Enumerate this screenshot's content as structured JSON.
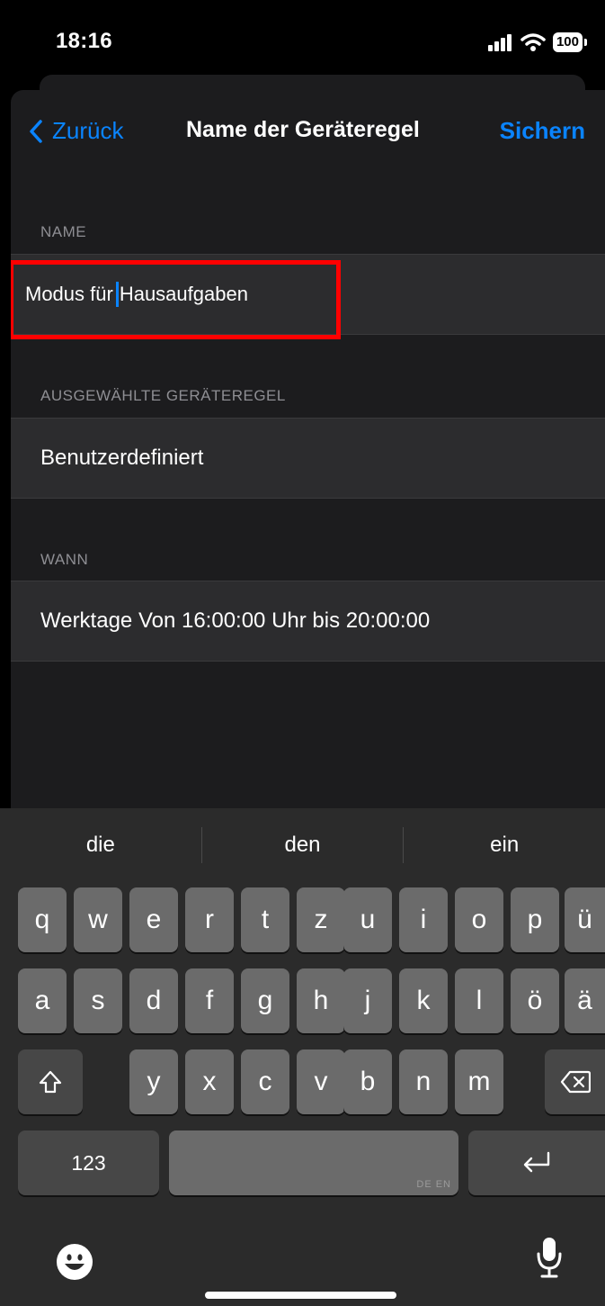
{
  "status_bar": {
    "time": "18:16",
    "battery": "100"
  },
  "nav": {
    "back_label": "Zurück",
    "title": "Name der Geräteregel",
    "save_label": "Sichern"
  },
  "sections": {
    "name_header": "NAME",
    "name_value_before_caret": "Modus für ",
    "name_value_after_caret": "Hausaufgaben",
    "rule_header": "AUSGEWÄHLTE GERÄTEREGEL",
    "rule_value": "Benutzerdefiniert",
    "when_header": "WANN",
    "when_value": "Werktage Von 16:00:00 Uhr bis 20:00:00"
  },
  "keyboard": {
    "suggestions": [
      "die",
      "den",
      "ein"
    ],
    "row1": [
      "q",
      "w",
      "e",
      "r",
      "t",
      "z",
      "u",
      "i",
      "o",
      "p",
      "ü"
    ],
    "row2": [
      "a",
      "s",
      "d",
      "f",
      "g",
      "h",
      "j",
      "k",
      "l",
      "ö",
      "ä"
    ],
    "row3": [
      "y",
      "x",
      "c",
      "v",
      "b",
      "n",
      "m"
    ],
    "numbers_key": "123",
    "space_sub": "DE EN"
  },
  "colors": {
    "accent": "#0a84ff",
    "highlight": "#ff0000",
    "background": "#1c1c1e"
  },
  "icons": [
    "back-chevron-icon",
    "cellular-signal-icon",
    "wifi-icon",
    "battery-icon",
    "shift-icon",
    "backspace-icon",
    "return-icon",
    "emoji-icon",
    "microphone-icon"
  ]
}
